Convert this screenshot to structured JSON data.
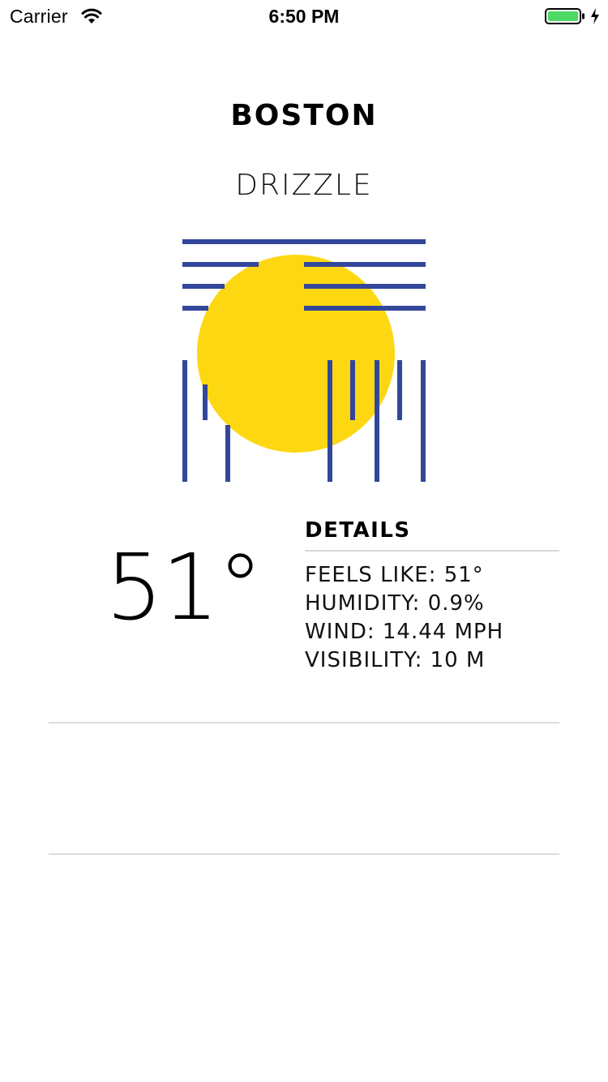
{
  "status_bar": {
    "carrier": "Carrier",
    "time": "6:50 PM",
    "wifi_icon": "wifi-icon",
    "battery_icon": "battery-icon",
    "charging_icon": "charging-bolt-icon",
    "battery_level": 1.0,
    "battery_color": "#4cd964"
  },
  "weather": {
    "city": "BOSTON",
    "condition": "DRIZZLE",
    "temperature": "51°",
    "icon": "drizzle-sun-icon",
    "icon_colors": {
      "sun": "#fdd812",
      "lines": "#33479a"
    }
  },
  "details": {
    "title": "DETAILS",
    "rows": [
      "FEELS LIKE: 51°",
      "HUMIDITY: 0.9%",
      "WIND: 14.44 MPH",
      "VISIBILITY: 10 M"
    ]
  }
}
